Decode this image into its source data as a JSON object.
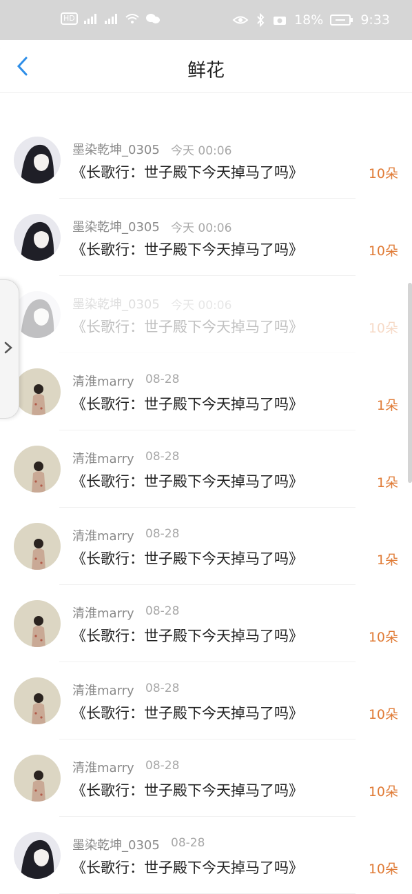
{
  "status_bar": {
    "left_icons": [
      "hd-icon",
      "signal-icon",
      "signal-4g-icon",
      "wifi-icon",
      "wechat-icon"
    ],
    "right_icons": [
      "eye-icon",
      "bluetooth-icon",
      "camera-icon"
    ],
    "battery_percent": "18%",
    "time": "9:33",
    "bg": "#d6d6d6"
  },
  "header": {
    "title": "鲜花",
    "back_icon": "chevron-left-icon",
    "back_color": "#2e8ee8"
  },
  "colors": {
    "accent": "#e07b36"
  },
  "rows": [
    {
      "user": "",
      "time": "",
      "book": "《长歌行：世子殿下今天掉马了吗》",
      "flowers": "10朵",
      "avatar": "dark-portrait",
      "partial": true
    },
    {
      "user": "墨染乾坤_0305",
      "time": "今天 00:06",
      "book": "《长歌行：世子殿下今天掉马了吗》",
      "flowers": "10朵",
      "avatar": "dark-portrait"
    },
    {
      "user": "墨染乾坤_0305",
      "time": "今天 00:06",
      "book": "《长歌行：世子殿下今天掉马了吗》",
      "flowers": "10朵",
      "avatar": "dark-portrait"
    },
    {
      "user": "墨染乾坤_0305",
      "time": "今天 00:06",
      "book": "《长歌行：世子殿下今天掉马了吗》",
      "flowers": "10朵",
      "avatar": "dark-portrait",
      "faded": true
    },
    {
      "user": "清淮marry",
      "time": "08-28",
      "book": "《长歌行：世子殿下今天掉马了吗》",
      "flowers": "1朵",
      "avatar": "beige-figure"
    },
    {
      "user": "清淮marry",
      "time": "08-28",
      "book": "《长歌行：世子殿下今天掉马了吗》",
      "flowers": "1朵",
      "avatar": "beige-figure"
    },
    {
      "user": "清淮marry",
      "time": "08-28",
      "book": "《长歌行：世子殿下今天掉马了吗》",
      "flowers": "1朵",
      "avatar": "beige-figure"
    },
    {
      "user": "清淮marry",
      "time": "08-28",
      "book": "《长歌行：世子殿下今天掉马了吗》",
      "flowers": "10朵",
      "avatar": "beige-figure"
    },
    {
      "user": "清淮marry",
      "time": "08-28",
      "book": "《长歌行：世子殿下今天掉马了吗》",
      "flowers": "10朵",
      "avatar": "beige-figure"
    },
    {
      "user": "清淮marry",
      "time": "08-28",
      "book": "《长歌行：世子殿下今天掉马了吗》",
      "flowers": "10朵",
      "avatar": "beige-figure"
    },
    {
      "user": "墨染乾坤_0305",
      "time": "08-28",
      "book": "《长歌行：世子殿下今天掉马了吗》",
      "flowers": "10朵",
      "avatar": "dark-portrait"
    }
  ],
  "side_tab": {
    "icon": "chevron-right-icon"
  }
}
